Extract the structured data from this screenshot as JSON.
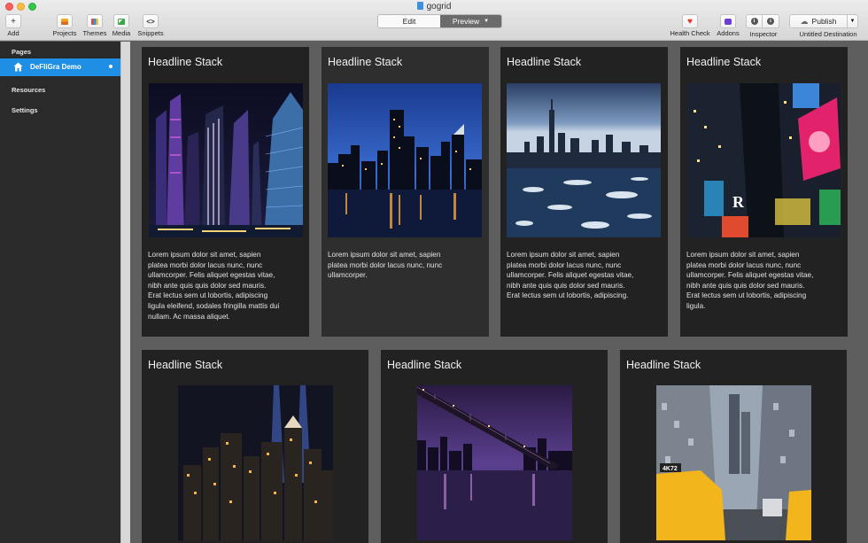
{
  "window": {
    "title": "gogrid"
  },
  "toolbar": {
    "left": [
      {
        "name": "add",
        "label": "Add",
        "icon": "plus-icon"
      },
      {
        "name": "projects",
        "label": "Projects",
        "icon": "projects-icon"
      },
      {
        "name": "themes",
        "label": "Themes",
        "icon": "themes-icon"
      },
      {
        "name": "media",
        "label": "Media",
        "icon": "media-icon"
      },
      {
        "name": "snippets",
        "label": "Snippets",
        "icon": "code-icon"
      }
    ],
    "mode": {
      "edit": "Edit",
      "preview": "Preview",
      "active": "preview"
    },
    "right": [
      {
        "name": "health-check",
        "label": "Health Check",
        "icon": "heart-icon"
      },
      {
        "name": "addons",
        "label": "Addons",
        "icon": "puzzle-icon"
      },
      {
        "name": "inspector",
        "label": "Inspector",
        "icon": "info-icon"
      }
    ],
    "publish": {
      "label": "Publish",
      "destination": "Untitled Destination",
      "icon": "cloud-icon"
    }
  },
  "sidebar": {
    "sections": {
      "pages": "Pages",
      "resources": "Resources",
      "settings": "Settings"
    },
    "pages": [
      {
        "label": "DeFliGra Demo",
        "icon": "house-icon",
        "selected": true
      }
    ]
  },
  "cards": [
    {
      "headline": "Headline Stack",
      "image": "skyscrapers-night-photo",
      "text": [
        "Lorem ipsum dolor sit amet, sapien",
        "platea morbi dolor lacus nunc, nunc",
        "ullamcorper. Felis aliquet egestas vitae,",
        "nibh ante quis quis dolor sed mauris.",
        "Erat lectus sem ut lobortis, adipiscing",
        "ligula eleifend, sodales fringilla mattis dui",
        "nullam. Ac massa aliquet."
      ]
    },
    {
      "headline": "Headline Stack",
      "image": "city-skyline-water-photo",
      "text": [
        "Lorem ipsum dolor sit amet, sapien",
        "platea morbi dolor lacus nunc, nunc",
        "ullamcorper."
      ]
    },
    {
      "headline": "Headline Stack",
      "image": "manhattan-ice-river-photo",
      "text": [
        "Lorem ipsum dolor sit amet, sapien",
        "platea morbi dolor lacus nunc, nunc",
        "ullamcorper. Felis aliquet egestas vitae,",
        "nibh ante quis quis dolor sed mauris.",
        "Erat lectus sem ut lobortis, adipiscing."
      ]
    },
    {
      "headline": "Headline Stack",
      "image": "times-square-photo",
      "text": [
        "Lorem ipsum dolor sit amet, sapien",
        "platea morbi dolor lacus nunc, nunc",
        "ullamcorper. Felis aliquet egestas vitae,",
        "nibh ante quis quis dolor sed mauris.",
        "Erat lectus sem ut lobortis, adipiscing",
        "ligula."
      ]
    },
    {
      "headline": "Headline Stack",
      "image": "tribute-in-light-photo",
      "text": []
    },
    {
      "headline": "Headline Stack",
      "image": "bridge-night-photo",
      "text": []
    },
    {
      "headline": "Headline Stack",
      "image": "yellow-taxi-street-photo",
      "text": []
    }
  ],
  "colors": {
    "accent": "#1f8fe6",
    "sidebar": "#2a2a2a",
    "card": "#222222",
    "canvas": "#5e5e5e"
  }
}
